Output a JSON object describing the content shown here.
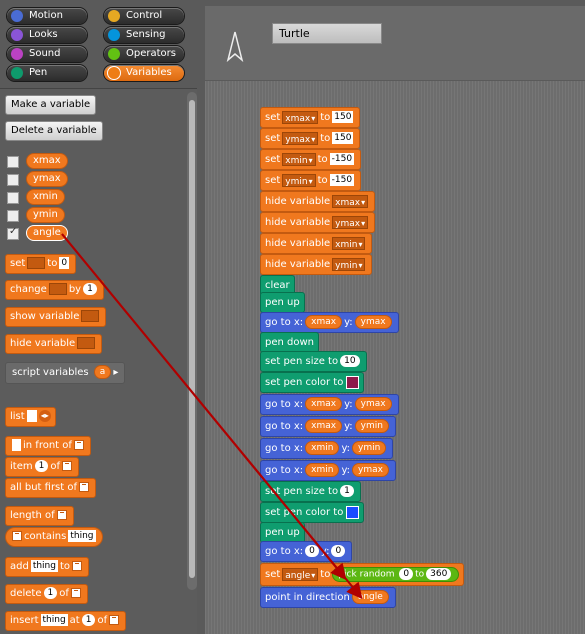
{
  "categories": [
    {
      "label": "Motion",
      "color": "#4a6cd4",
      "selected": false
    },
    {
      "label": "Control",
      "color": "#e6a822",
      "selected": false
    },
    {
      "label": "Looks",
      "color": "#8a55d7",
      "selected": false
    },
    {
      "label": "Sensing",
      "color": "#0494dc",
      "selected": false
    },
    {
      "label": "Sound",
      "color": "#bb42c3",
      "selected": false
    },
    {
      "label": "Operators",
      "color": "#62c213",
      "selected": false
    },
    {
      "label": "Pen",
      "color": "#0e9a6c",
      "selected": false
    },
    {
      "label": "Variables",
      "color": "#ee7d16",
      "selected": true
    }
  ],
  "palette": {
    "make_variable": "Make a variable",
    "delete_variable": "Delete a variable",
    "variables": [
      {
        "name": "xmax",
        "checked": false
      },
      {
        "name": "ymax",
        "checked": false
      },
      {
        "name": "xmin",
        "checked": false
      },
      {
        "name": "ymin",
        "checked": false
      },
      {
        "name": "angle",
        "checked": true
      }
    ],
    "checkmark": "✓",
    "set_block": {
      "label": "set",
      "to": "to",
      "value": "0"
    },
    "change_block": {
      "label": "change",
      "by": "by",
      "value": "1"
    },
    "show_variable": "show variable",
    "hide_variable": "hide variable",
    "script_variables": {
      "label": "script variables",
      "var": "a",
      "arrow": "▸"
    },
    "list_block": {
      "label": "list",
      "arrows": "◂▸"
    },
    "in_front_of": "in front of",
    "item_block": {
      "label": "item",
      "value": "1",
      "of": "of"
    },
    "all_but_first": "all but first of",
    "length_of": "length of",
    "contains": {
      "label": "contains",
      "value": "thing"
    },
    "add_block": {
      "label": "add",
      "value": "thing",
      "to": "to"
    },
    "delete_block": {
      "label": "delete",
      "value": "1",
      "of": "of"
    },
    "insert_block": {
      "label": "insert",
      "value": "thing",
      "at": "at",
      "index": "1",
      "of": "of"
    }
  },
  "sprite": {
    "name": "Turtle"
  },
  "script": {
    "set1": {
      "label": "set",
      "var": "xmax",
      "to": "to",
      "value": "150"
    },
    "set2": {
      "label": "set",
      "var": "ymax",
      "to": "to",
      "value": "150"
    },
    "set3": {
      "label": "set",
      "var": "xmin",
      "to": "to",
      "value": "-150"
    },
    "set4": {
      "label": "set",
      "var": "ymin",
      "to": "to",
      "value": "-150"
    },
    "hide1": {
      "label": "hide variable",
      "var": "xmax"
    },
    "hide2": {
      "label": "hide variable",
      "var": "ymax"
    },
    "hide3": {
      "label": "hide variable",
      "var": "xmin"
    },
    "hide4": {
      "label": "hide variable",
      "var": "ymin"
    },
    "clear": "clear",
    "pen_up": "pen up",
    "goto1": {
      "label": "go to x:",
      "x": "xmax",
      "y_label": "y:",
      "y": "ymax"
    },
    "pen_down": "pen down",
    "set_pen_size": {
      "label": "set pen size to",
      "value": "10"
    },
    "set_pen_color": {
      "label": "set pen color to",
      "color": "#8e1a4a"
    },
    "goto2": {
      "label": "go to x:",
      "x": "xmax",
      "y_label": "y:",
      "y": "ymax"
    },
    "goto3": {
      "label": "go to x:",
      "x": "xmax",
      "y_label": "y:",
      "y": "ymin"
    },
    "goto4": {
      "label": "go to x:",
      "x": "xmin",
      "y_label": "y:",
      "y": "ymin"
    },
    "goto5": {
      "label": "go to x:",
      "x": "xmin",
      "y_label": "y:",
      "y": "ymax"
    },
    "set_pen_size2": {
      "label": "set pen size to",
      "value": "1"
    },
    "set_pen_color2": {
      "label": "set pen color to",
      "color": "#1a4cff"
    },
    "pen_up2": "pen up",
    "goto6": {
      "label": "go to x:",
      "x": "0",
      "y_label": "y:",
      "y": "0"
    },
    "set_angle": {
      "label": "set",
      "var": "angle",
      "to": "to",
      "op": "pick random",
      "from": "0",
      "to_label": "to",
      "max": "360"
    },
    "point_dir": {
      "label": "point in direction",
      "var": "angle"
    }
  },
  "colors": {
    "variables": "#f0781e",
    "pen": "#0f9d6f",
    "motion": "#4563d6",
    "operators": "#5cb712",
    "arrow": "#b00000"
  }
}
